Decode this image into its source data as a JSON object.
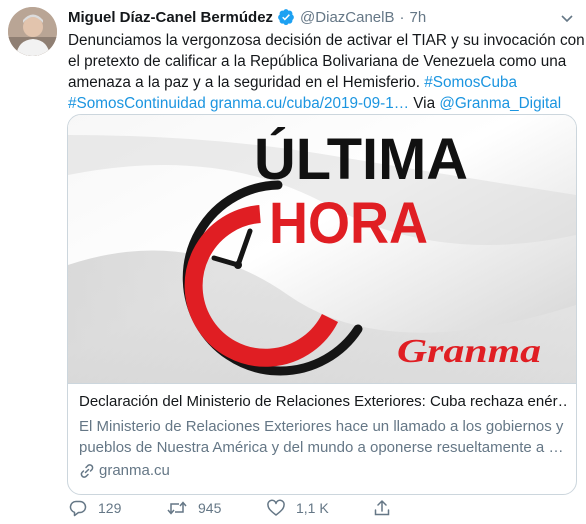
{
  "author": {
    "name": "Miguel Díaz-Canel Bermúdez",
    "handle": "@DiazCanelB",
    "separator": "·",
    "time": "7h"
  },
  "tweet": {
    "line1": "Denunciamos la vergonzosa decisión de activar el TIAR y  su invocación con",
    "line2": "el pretexto de calificar a la República Bolivariana de Venezuela como una",
    "line3_text": "amenaza a la paz y a la seguridad en el Hemisferio. ",
    "hashtag1": "#SomosCuba",
    "hashtag2": "#SomosContinuidad",
    "url": "granma.cu/cuba/2019-09-1…",
    "via_label": "Via ",
    "via_mention": "@Granma_Digital"
  },
  "card": {
    "image_words": {
      "line1": "ÚLTIMA",
      "line2": "HORA",
      "brand": "Granma"
    },
    "title": "Declaración del Ministerio de Relaciones Exteriores: Cuba rechaza enér…",
    "description_line1": "El Ministerio de Relaciones Exteriores hace un llamado a los gobiernos y",
    "description_line2": "pueblos de Nuestra América y del mundo a oponerse resueltamente a …",
    "domain": "granma.cu"
  },
  "actions": {
    "replies": "129",
    "retweets": "945",
    "likes": "1,1 K"
  },
  "colors": {
    "link": "#1b95e0",
    "secondary": "#657786",
    "verified": "#1da1f2",
    "clock_red": "#e01e23"
  }
}
